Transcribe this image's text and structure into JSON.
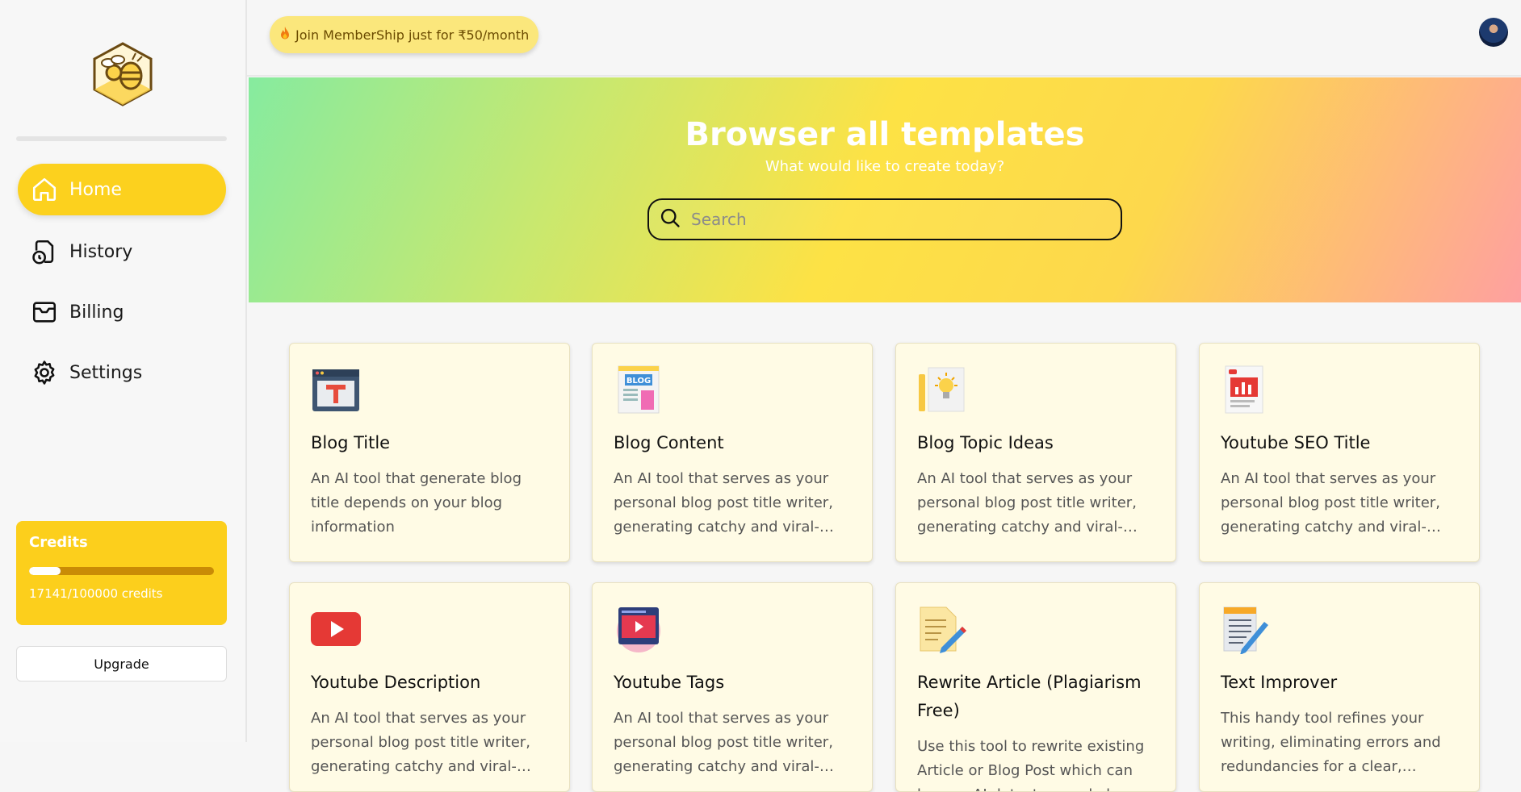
{
  "colors": {
    "accent": "#fcd11e",
    "credits_bg": "#fccf1c",
    "card_bg": "#fffbe5"
  },
  "sidebar": {
    "logo": "bee-hive-logo",
    "items": [
      {
        "label": "Home",
        "icon": "home-icon",
        "active": true
      },
      {
        "label": "History",
        "icon": "history-icon",
        "active": false
      },
      {
        "label": "Billing",
        "icon": "wallet-icon",
        "active": false
      },
      {
        "label": "Settings",
        "icon": "gear-icon",
        "active": false
      }
    ],
    "credits": {
      "title": "Credits",
      "used": 17141,
      "total": 100000,
      "text": "17141/100000 credits"
    },
    "upgrade_label": "Upgrade"
  },
  "header": {
    "promo": "Join MemberShip just for ₹50/month",
    "promo_icon": "flame-icon",
    "avatar": "user-avatar"
  },
  "hero": {
    "title": "Browser all templates",
    "subtitle": "What would like to create today?",
    "search_placeholder": "Search",
    "search_icon": "search-icon"
  },
  "templates": [
    {
      "title": "Blog Title",
      "desc": "An AI tool that generate blog title depends on your blog information",
      "icon": "blog-title-icon"
    },
    {
      "title": "Blog Content",
      "desc": "An AI tool that serves as your personal blog post title writer, generating catchy and viral-worthy titles in your chosen language.",
      "icon": "blog-content-icon"
    },
    {
      "title": "Blog Topic Ideas",
      "desc": "An AI tool that serves as your personal blog post title writer, generating catchy and viral-worthy titles in your chosen language.",
      "icon": "lightbulb-icon"
    },
    {
      "title": "Youtube SEO Title",
      "desc": "An AI tool that serves as your personal blog post title writer, generating catchy and viral-worthy titles in your chosen language.",
      "icon": "youtube-seo-icon"
    },
    {
      "title": "Youtube Description",
      "desc": "An AI tool that serves as your personal blog post title writer, generating catchy and viral-worthy titles in your chosen language.",
      "icon": "youtube-icon"
    },
    {
      "title": "Youtube Tags",
      "desc": "An AI tool that serves as your personal blog post title writer, generating catchy and viral-worthy titles in your chosen language.",
      "icon": "video-tags-icon"
    },
    {
      "title": "Rewrite Article (Plagiarism Free)",
      "desc": "Use this tool to rewrite existing Article or Blog Post which can bypass AI detectors and also make it plagiarism free.",
      "icon": "rewrite-icon"
    },
    {
      "title": "Text Improver",
      "desc": "This handy tool refines your writing, eliminating errors and redundancies for a clear, readable result.",
      "icon": "text-improver-icon"
    }
  ]
}
